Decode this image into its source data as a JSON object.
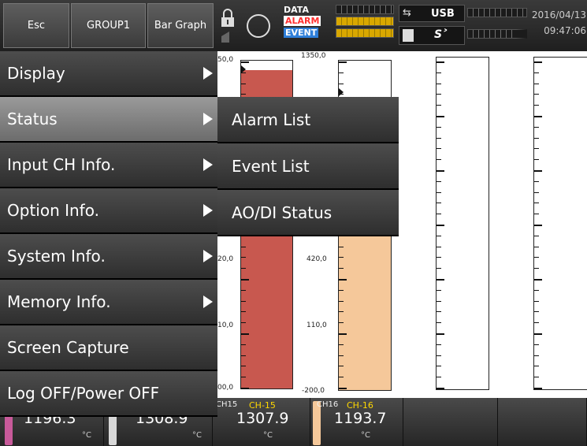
{
  "topbar": {
    "esc_label": "Esc",
    "group_label": "GROUP1",
    "view_label": "Bar Graph",
    "legend": {
      "data": "DATA",
      "alarm": "ALARM",
      "event": "EVENT"
    },
    "usb_label": "USB",
    "date": "2016/04/13",
    "time": "09:47:06"
  },
  "graph": {
    "col1_scale": [
      "50,0",
      "20,0",
      "10,0",
      "00,0"
    ],
    "col2_scale": [
      "1350,0",
      "420,0",
      "110,0",
      "-200,0"
    ],
    "col1_fill_fraction": 0.97,
    "col2_fill_fraction": 0.88,
    "col1_color": "#c8584f",
    "col2_color": "#f5c89a"
  },
  "bottom": {
    "cells": [
      {
        "value": "1196.3",
        "unit": "°C",
        "color": "#c85a9a"
      },
      {
        "value": "1308.9",
        "unit": "°C",
        "color": "#d8d8d8"
      },
      {
        "tag": "CH15",
        "name": "CH-15",
        "value": "1307.9",
        "unit": "°C",
        "color": "#e070b0"
      },
      {
        "tag": "CH16",
        "name": "CH-16",
        "value": "1193.7",
        "unit": "°C",
        "color": "#f5c89a"
      }
    ]
  },
  "menu": {
    "items": [
      {
        "label": "Display",
        "has_submenu": true
      },
      {
        "label": "Status",
        "has_submenu": true,
        "selected": true
      },
      {
        "label": "Input CH Info.",
        "has_submenu": true
      },
      {
        "label": "Option Info.",
        "has_submenu": true
      },
      {
        "label": "System Info.",
        "has_submenu": true
      },
      {
        "label": "Memory Info.",
        "has_submenu": true
      },
      {
        "label": "Screen Capture",
        "has_submenu": false
      },
      {
        "label": "Log OFF/Power OFF",
        "has_submenu": false
      }
    ],
    "submenu": [
      {
        "label": "Alarm List"
      },
      {
        "label": "Event List"
      },
      {
        "label": "AO/DI Status"
      }
    ]
  }
}
